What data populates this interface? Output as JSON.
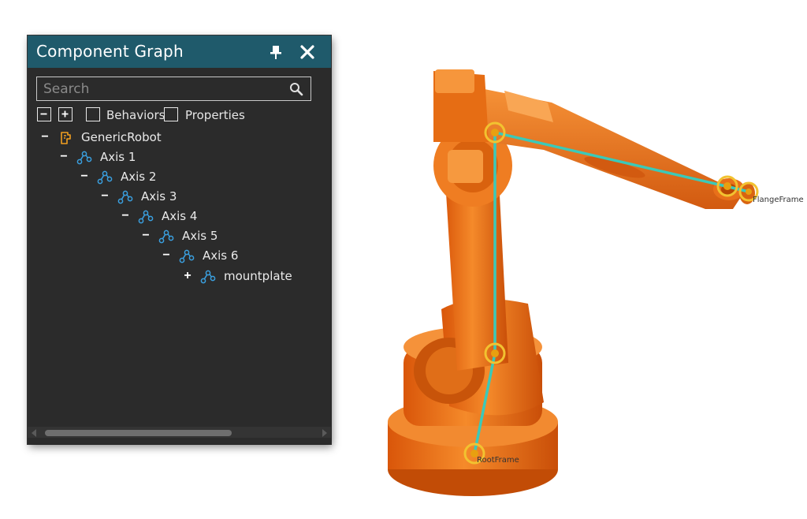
{
  "panel": {
    "title": "Component Graph",
    "pin_icon": "pin-icon",
    "close_icon": "close-icon"
  },
  "search": {
    "placeholder": "Search",
    "value": "",
    "icon": "search-icon"
  },
  "toolbar": {
    "collapse_all_icon": "minus-box-icon",
    "expand_all_icon": "plus-box-icon",
    "behaviors_label": "Behaviors",
    "behaviors_checked": false,
    "properties_label": "Properties",
    "properties_checked": false
  },
  "tree": [
    {
      "label": "GenericRobot",
      "toggle": "−",
      "icon": "component-icon",
      "depth": 0
    },
    {
      "label": "Axis 1",
      "toggle": "−",
      "icon": "node-link-icon",
      "depth": 1
    },
    {
      "label": "Axis 2",
      "toggle": "−",
      "icon": "node-link-icon",
      "depth": 2
    },
    {
      "label": "Axis 3",
      "toggle": "−",
      "icon": "node-link-icon",
      "depth": 3
    },
    {
      "label": "Axis 4",
      "toggle": "−",
      "icon": "node-link-icon",
      "depth": 4
    },
    {
      "label": "Axis 5",
      "toggle": "−",
      "icon": "node-link-icon",
      "depth": 5
    },
    {
      "label": "Axis 6",
      "toggle": "−",
      "icon": "node-link-icon",
      "depth": 6
    },
    {
      "label": "mountplate",
      "toggle": "+",
      "icon": "node-link-icon",
      "depth": 7
    }
  ],
  "viewport": {
    "flange_frame_label": "FlangeFrame",
    "root_frame_label": "RootFrame",
    "robot_color": "#f07a1a",
    "link_line_color": "#3cc9b8",
    "frame_marker_color": "#f2c230"
  },
  "colors": {
    "titlebar": "#1f5a6b",
    "panel_bg": "#2b2b2b",
    "tree_icon_blue": "#3aa0e0",
    "component_icon": "#f2a020"
  }
}
